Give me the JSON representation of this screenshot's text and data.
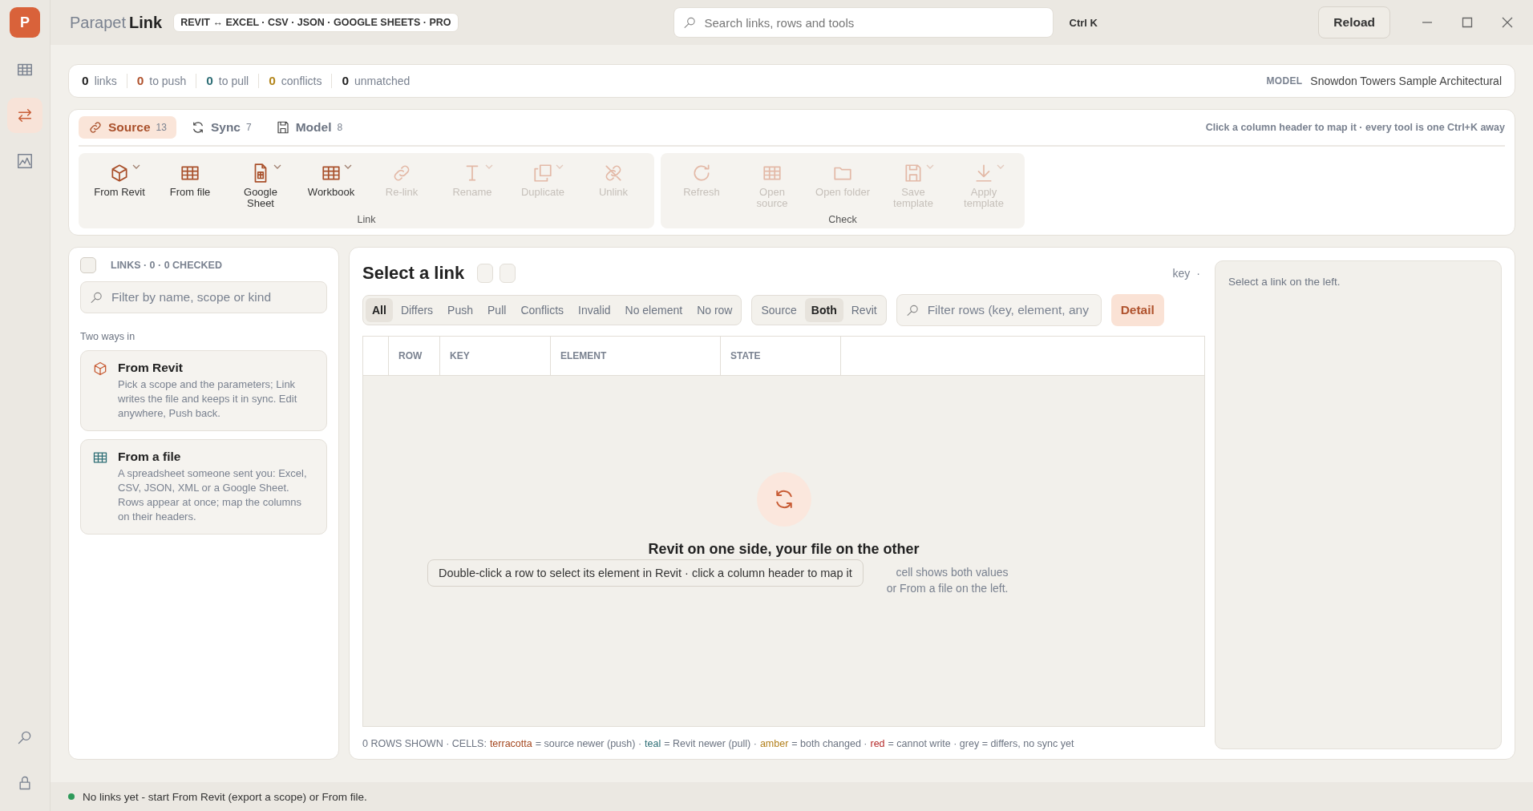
{
  "app": {
    "logo": "P",
    "name_light": "Parapet",
    "name_bold": "Link",
    "formats_badge": "REVIT ↔ EXCEL · CSV · JSON · GOOGLE SHEETS · PRO"
  },
  "search": {
    "placeholder": "Search links, rows and tools",
    "shortcut": "Ctrl K"
  },
  "reload_button": "Reload",
  "rail": [
    {
      "kind": "table",
      "selected": false
    },
    {
      "kind": "swap",
      "selected": true
    },
    {
      "kind": "chart",
      "selected": false
    }
  ],
  "rail_bottom": [
    {
      "kind": "search"
    },
    {
      "kind": "lock"
    }
  ],
  "stats": [
    {
      "count": "0",
      "label": "links",
      "color": "#1f1f1f"
    },
    {
      "count": "0",
      "label": "to push",
      "color": "#b0532e"
    },
    {
      "count": "0",
      "label": "to pull",
      "color": "#2e6e76"
    },
    {
      "count": "0",
      "label": "conflicts",
      "color": "#b3861c"
    },
    {
      "count": "0",
      "label": "unmatched",
      "color": "#1f1f1f"
    }
  ],
  "model": {
    "label": "MODEL",
    "value": "Snowdon Towers Sample Architectural"
  },
  "tabs": [
    {
      "label": "Source",
      "count": "13",
      "kind": "link",
      "selected": true
    },
    {
      "label": "Sync",
      "count": "7",
      "kind": "sync",
      "selected": false
    },
    {
      "label": "Model",
      "count": "8",
      "kind": "save",
      "selected": false
    }
  ],
  "hint": "Click a column header to map it · every tool is one Ctrl+K away",
  "ribbon_groups": [
    {
      "label": "Link",
      "tools": [
        {
          "label": "From Revit",
          "kind": "cube",
          "disabled": false,
          "dropdown": true
        },
        {
          "label": "From file",
          "kind": "grid",
          "disabled": false,
          "dropdown": false
        },
        {
          "label": "Google Sheet",
          "kind": "sheet",
          "disabled": false,
          "dropdown": true
        },
        {
          "label": "Workbook",
          "kind": "grid",
          "disabled": false,
          "dropdown": true
        },
        {
          "label": "Re-link",
          "kind": "link",
          "disabled": true,
          "dropdown": false
        },
        {
          "label": "Rename",
          "kind": "text",
          "disabled": true,
          "dropdown": true
        },
        {
          "label": "Duplicate",
          "kind": "copy",
          "disabled": true,
          "dropdown": true
        },
        {
          "label": "Unlink",
          "kind": "unlink",
          "disabled": true,
          "dropdown": false
        }
      ]
    },
    {
      "label": "Check",
      "tools": [
        {
          "label": "Refresh",
          "kind": "refresh",
          "disabled": true,
          "dropdown": false
        },
        {
          "label": "Open source",
          "kind": "grid",
          "disabled": true,
          "dropdown": false
        },
        {
          "label": "Open folder",
          "kind": "folder",
          "disabled": true,
          "dropdown": false
        },
        {
          "label": "Save template",
          "kind": "save",
          "disabled": true,
          "dropdown": true
        },
        {
          "label": "Apply template",
          "kind": "download",
          "disabled": true,
          "dropdown": true
        }
      ]
    }
  ],
  "links_panel": {
    "checked": false,
    "heading": "LINKS · 0 · 0 CHECKED",
    "filter_placeholder": "Filter by name, scope or kind",
    "section": "Two ways in",
    "ways": [
      {
        "kind": "revit",
        "title": "From Revit",
        "text": "Pick a scope and the parameters; Link writes the file and keeps it in sync. Edit anywhere, Push back."
      },
      {
        "kind": "file",
        "title": "From a file",
        "text": "A spreadsheet someone sent you: Excel, CSV, JSON, XML or a Google Sheet. Rows appear at once; map the columns on their headers."
      }
    ]
  },
  "center": {
    "title": "Select a link",
    "key_label": "key",
    "key_value": "·",
    "filters": [
      {
        "label": "All",
        "selected": true
      },
      {
        "label": "Differs",
        "selected": false
      },
      {
        "label": "Push",
        "selected": false
      },
      {
        "label": "Pull",
        "selected": false
      },
      {
        "label": "Conflicts",
        "selected": false
      },
      {
        "label": "Invalid",
        "selected": false
      },
      {
        "label": "No element",
        "selected": false
      },
      {
        "label": "No row",
        "selected": false
      }
    ],
    "sides": [
      {
        "label": "Source",
        "selected": false
      },
      {
        "label": "Both",
        "selected": true
      },
      {
        "label": "Revit",
        "selected": false
      }
    ],
    "row_filter_placeholder": "Filter rows (key, element, any",
    "detail_button": "Detail",
    "table": {
      "columns": [
        "ROW",
        "KEY",
        "ELEMENT",
        "STATE"
      ]
    },
    "empty": {
      "title": "Revit on one side, your file on the other",
      "lines": [
        "cell shows both values",
        "or From a file on the left."
      ]
    },
    "tooltip": "Double-click a row to select its element in Revit · click a column header to map it",
    "legend": [
      {
        "text": "0 ROWS SHOWN · CELLS:"
      },
      {
        "text": "terracotta",
        "color": "#a4471f"
      },
      {
        "text": "= source newer (push) ·"
      },
      {
        "text": "teal",
        "color": "#2e6e76"
      },
      {
        "text": "= Revit newer (pull) ·"
      },
      {
        "text": "amber",
        "color": "#b3801c"
      },
      {
        "text": "= both changed ·"
      },
      {
        "text": "red",
        "color": "#b52a2a"
      },
      {
        "text": "= cannot write · grey = differs, no sync yet"
      }
    ]
  },
  "detail_panel": {
    "text": "Select a link on the left."
  },
  "status": {
    "text": "No links yet - start From Revit (export a scope) or From file.",
    "color": "#2e9a5a"
  }
}
